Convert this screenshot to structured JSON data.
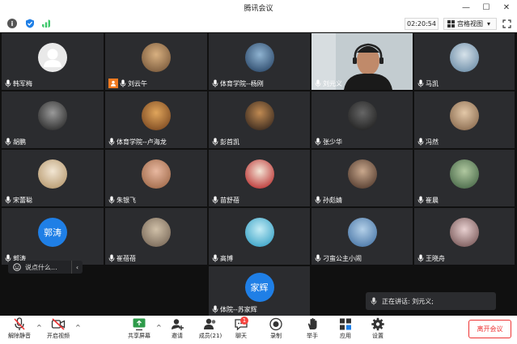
{
  "window": {
    "title": "腾讯会议"
  },
  "toolbar": {
    "timer": "02:20:54",
    "view_label": "宫格视图"
  },
  "participants": [
    {
      "name": "韩军梅",
      "avatar": "default"
    },
    {
      "name": "刘云午",
      "avatar": "photo",
      "host": true
    },
    {
      "name": "体育学院--杨刚",
      "avatar": "photo"
    },
    {
      "name": "刘元义",
      "avatar": "video",
      "active": true
    },
    {
      "name": "马凯",
      "avatar": "photo"
    },
    {
      "name": "胡鹏",
      "avatar": "photo"
    },
    {
      "name": "体育学院--卢海龙",
      "avatar": "photo"
    },
    {
      "name": "彭首凯",
      "avatar": "photo"
    },
    {
      "name": "张少华",
      "avatar": "photo"
    },
    {
      "name": "冯然",
      "avatar": "photo"
    },
    {
      "name": "宋蕾聪",
      "avatar": "photo"
    },
    {
      "name": "朱银飞",
      "avatar": "photo"
    },
    {
      "name": "苗舒蓓",
      "avatar": "photo"
    },
    {
      "name": "孙彪婧",
      "avatar": "photo"
    },
    {
      "name": "崔晨",
      "avatar": "photo"
    },
    {
      "name": "郭涛",
      "avatar": "text",
      "avatar_text": "郭涛"
    },
    {
      "name": "崔蓓蓓",
      "avatar": "photo"
    },
    {
      "name": "高博",
      "avatar": "photo"
    },
    {
      "name": "刁蛮公主小闹",
      "avatar": "photo"
    },
    {
      "name": "王晓舟",
      "avatar": "photo"
    },
    {
      "name": "体院--苏家辉",
      "avatar": "text",
      "avatar_text": "家辉"
    }
  ],
  "chat_popup": {
    "placeholder": "说点什么..."
  },
  "speaking": {
    "label": "正在讲话: 刘元义;"
  },
  "controls": {
    "mute": "解除静音",
    "video": "开启视频",
    "share": "共享屏幕",
    "invite": "邀请",
    "members": "成员(21)",
    "chat": "聊天",
    "chat_badge": "1",
    "record": "录制",
    "raise": "举手",
    "apps": "应用",
    "settings": "设置",
    "leave": "离开会议"
  },
  "colors": {
    "accent_blue": "#1f7fe6",
    "active_border": "#3fc86b",
    "danger": "#e33333",
    "host_orange": "#f07a21"
  }
}
